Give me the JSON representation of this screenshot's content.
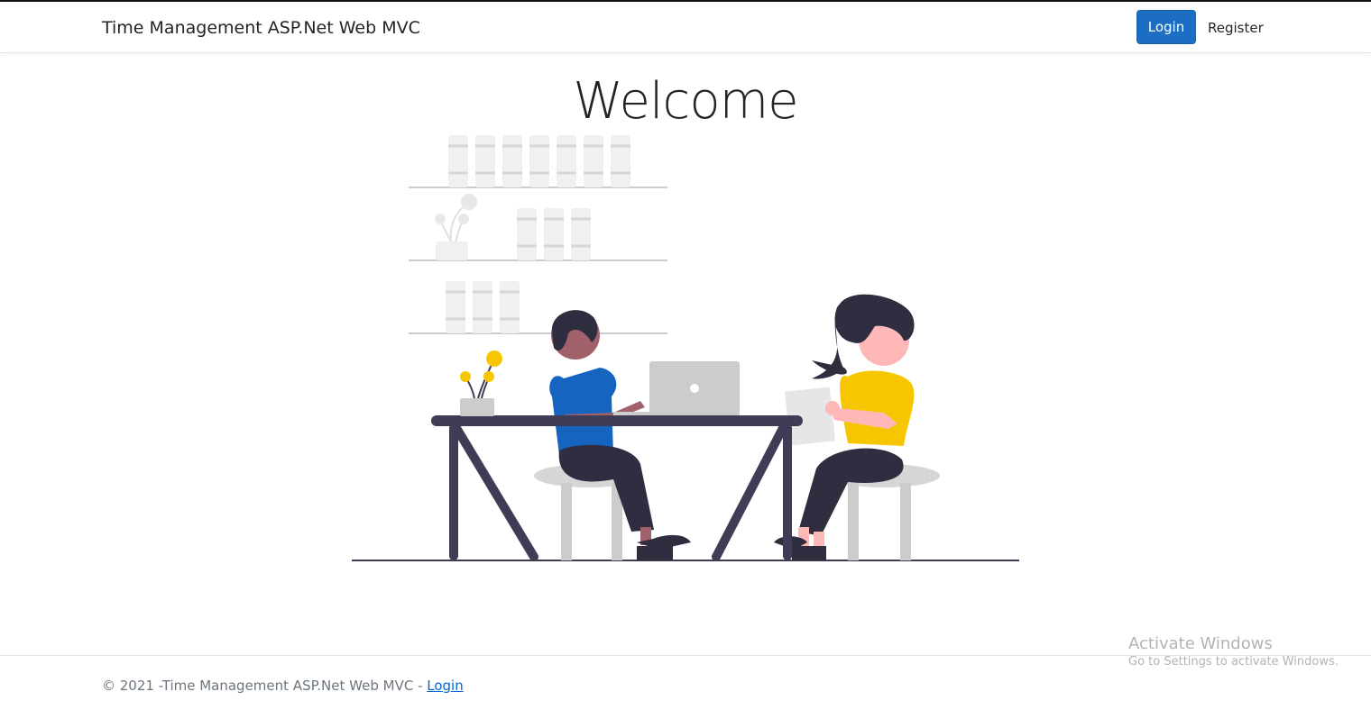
{
  "navbar": {
    "brand": "Time Management ASP.Net Web MVC",
    "login_label": "Login",
    "register_label": "Register"
  },
  "main": {
    "heading": "Welcome"
  },
  "footer": {
    "text": "© 2021 -Time Management ASP.Net Web MVC - ",
    "link_label": "Login"
  },
  "overlay": {
    "title": "Activate Windows",
    "subtitle": "Go to Settings to activate Windows."
  },
  "colors": {
    "primary": "#1b6ec2",
    "person1_shirt": "#1565c0",
    "person2_shirt": "#f6c700",
    "table": "#3f3d56",
    "plant_flower": "#f6c700"
  }
}
